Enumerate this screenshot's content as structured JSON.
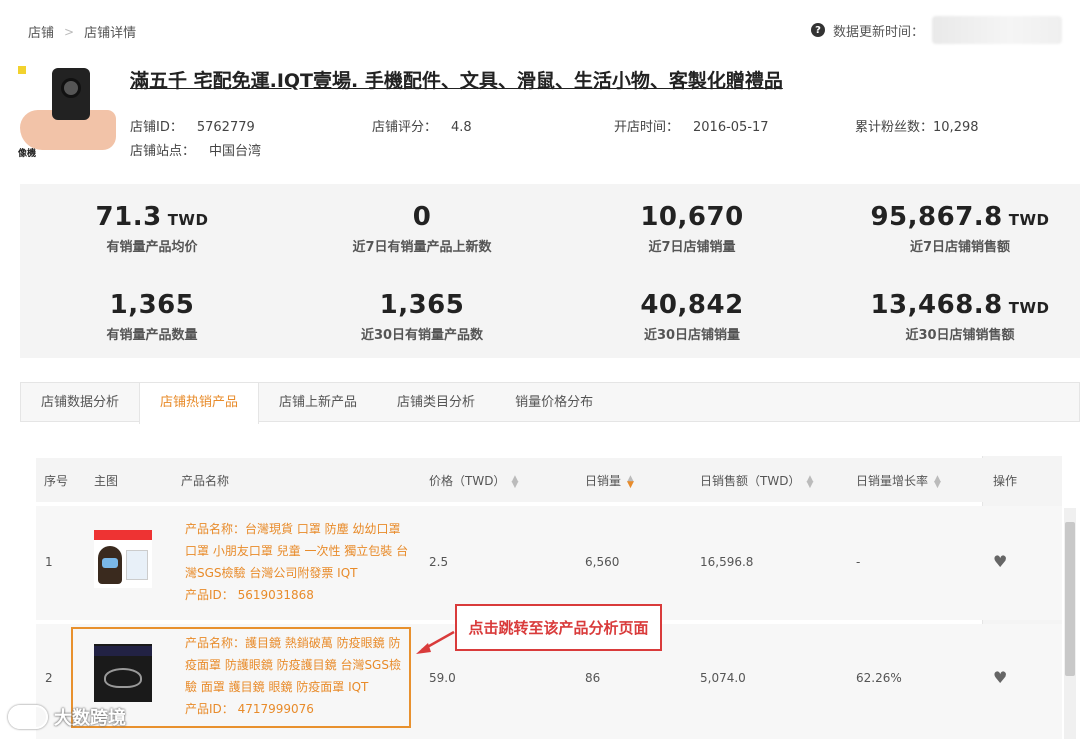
{
  "breadcrumb": {
    "home": "店铺",
    "separator": ">",
    "current": "店铺详情"
  },
  "update": {
    "label": "数据更新时间："
  },
  "shop": {
    "thumb_caption": "像機",
    "title": "滿五千 宅配免運.IQT壹場. 手機配件、文具、滑鼠、生活小物、客製化贈禮品",
    "id_label": "店铺ID：",
    "id_value": "5762779",
    "rating_label": "店铺评分：",
    "rating_value": "4.8",
    "open_label": "开店时间：",
    "open_value": "2016-05-17",
    "fans_label": "累计粉丝数：",
    "fans_value": "10,298",
    "site_label": "店铺站点：",
    "site_value": "中国台湾"
  },
  "stats": [
    {
      "value": "71.3",
      "unit": "TWD",
      "label": "有销量产品均价"
    },
    {
      "value": "0",
      "unit": "",
      "label": "近7日有销量产品上新数"
    },
    {
      "value": "10,670",
      "unit": "",
      "label": "近7日店铺销量"
    },
    {
      "value": "95,867.8",
      "unit": "TWD",
      "label": "近7日店铺销售额"
    },
    {
      "value": "1,365",
      "unit": "",
      "label": "有销量产品数量"
    },
    {
      "value": "1,365",
      "unit": "",
      "label": "近30日有销量产品数"
    },
    {
      "value": "40,842",
      "unit": "",
      "label": "近30日店铺销量"
    },
    {
      "value": "13,468.8",
      "unit": "TWD",
      "label": "近30日店铺销售额"
    }
  ],
  "tabs": [
    "店铺数据分析",
    "店铺热销产品",
    "店铺上新产品",
    "店铺类目分析",
    "销量价格分布"
  ],
  "table": {
    "headers": {
      "index": "序号",
      "image": "主图",
      "name": "产品名称",
      "price": "价格（TWD）",
      "daily_sales": "日销量",
      "daily_revenue": "日销售额（TWD）",
      "growth": "日销量增长率",
      "action": "操作"
    },
    "rows": [
      {
        "index": "1",
        "name_lines": [
          "产品名称：台灣現貨 口罩 防塵 幼幼口罩",
          "口罩 小朋友口罩 兒童 一次性 獨立包裝 台",
          "灣SGS檢驗 台灣公司附發票 IQT"
        ],
        "product_id": "产品ID： 5619031868",
        "price": "2.5",
        "daily_sales": "6,560",
        "daily_revenue": "16,596.8",
        "growth": "-"
      },
      {
        "index": "2",
        "name_lines": [
          "产品名称：護目鏡 熱銷破萬 防疫眼鏡 防",
          "疫面罩 防護眼鏡 防疫護目鏡 台灣SGS檢",
          "驗 面罩 護目鏡 眼鏡 防疫面罩 IQT"
        ],
        "product_id": "产品ID： 4717999076",
        "price": "59.0",
        "daily_sales": "86",
        "daily_revenue": "5,074.0",
        "growth": "62.26%"
      }
    ]
  },
  "callout": "点击跳转至该产品分析页面",
  "watermark": "大数跨境",
  "colors": {
    "accent": "#e88b2a",
    "callout": "#d93b3b",
    "panel": "#f4f4f4"
  },
  "icons": {
    "question": "question-circle-icon",
    "heart": "heart-icon",
    "sort": "sort-icon"
  }
}
